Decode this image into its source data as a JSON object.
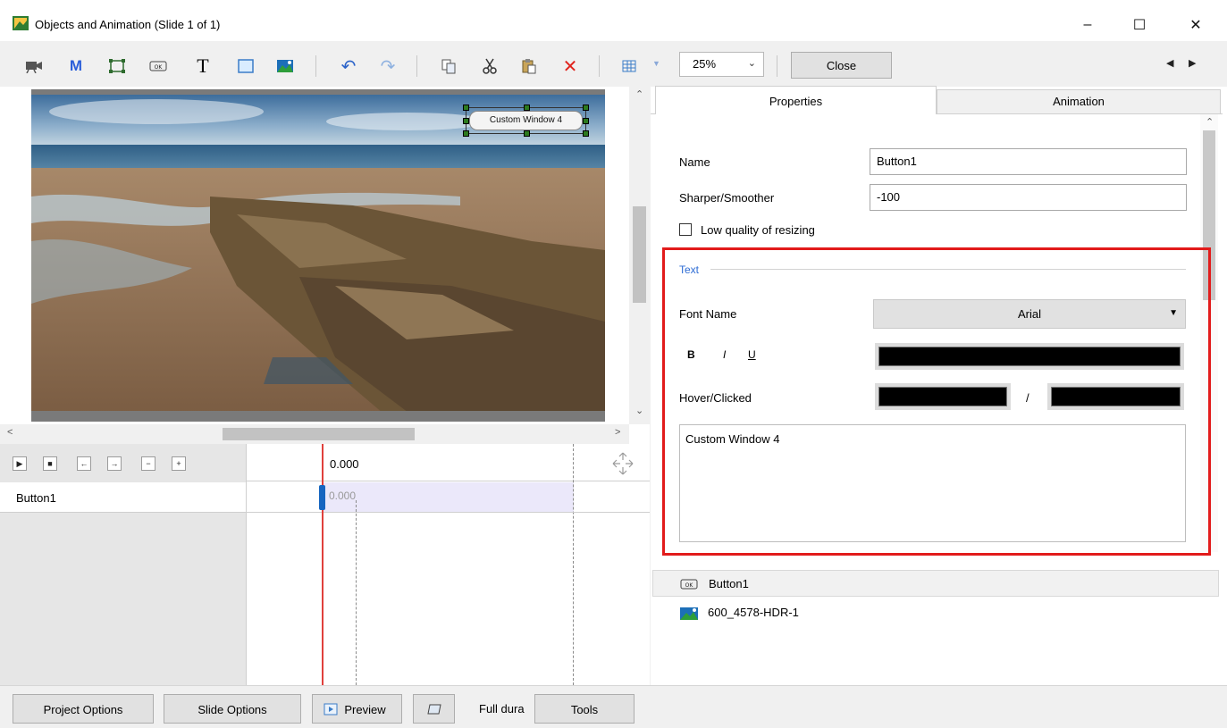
{
  "window": {
    "title": "Objects and Animation (Slide 1 of 1)",
    "minimize": "–",
    "maximize": "☐",
    "close": "✕"
  },
  "toolbar": {
    "zoom_value": "25%",
    "close_label": "Close",
    "text_tool": "T",
    "mask_tool": "M",
    "undo": "↶",
    "redo": "↷",
    "delete": "✕"
  },
  "canvas": {
    "button_text": "Custom Window 4"
  },
  "timeline": {
    "time_label": "0.000",
    "track_value": "0.000",
    "row_name": "Button1",
    "buttons": [
      "▶",
      "■",
      "←",
      "→",
      "−",
      "+"
    ]
  },
  "tabs": {
    "properties": "Properties",
    "animation": "Animation"
  },
  "properties": {
    "name_label": "Name",
    "name_value": "Button1",
    "sharper_label": "Sharper/Smoother",
    "sharper_value": "-100",
    "lowq_label": "Low quality of resizing",
    "text_group": "Text",
    "font_label": "Font Name",
    "font_value": "Arial",
    "style_b": "B",
    "style_i": "I",
    "style_u": "U",
    "hover_label": "Hover/Clicked",
    "hover_sep": "/",
    "text_value": "Custom Window 4",
    "highlight_color": "#e21b1b"
  },
  "object_list": [
    {
      "name": "Button1",
      "icon": "button-object-icon"
    },
    {
      "name": "600_4578-HDR-1",
      "icon": "image-object-icon"
    }
  ],
  "bottom": {
    "project_options": "Project Options",
    "slide_options": "Slide Options",
    "preview": "Preview",
    "full_duration": "Full dura",
    "tools": "Tools"
  }
}
